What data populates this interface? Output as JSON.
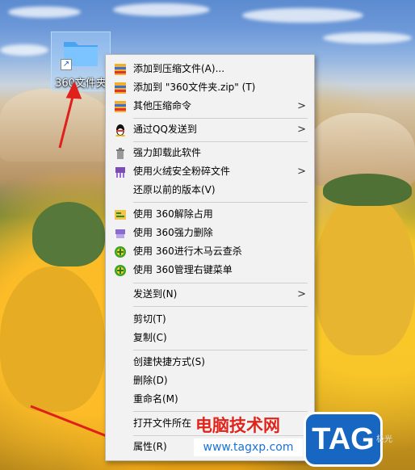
{
  "desktop_icon": {
    "label": "360文件夹"
  },
  "context_menu": {
    "items": [
      {
        "label": "添加到压缩文件(A)...",
        "icon": "archive-icon",
        "submenu": false
      },
      {
        "label": "添加到 \"360文件夹.zip\" (T)",
        "icon": "archive-icon",
        "submenu": false
      },
      {
        "label": "其他压缩命令",
        "icon": "archive-icon",
        "submenu": true
      },
      {
        "label": "通过QQ发送到",
        "icon": "qq-penguin-icon",
        "submenu": true
      },
      {
        "label": "强力卸载此软件",
        "icon": "trash-icon",
        "submenu": false
      },
      {
        "label": "使用火绒安全粉碎文件",
        "icon": "shredder-icon",
        "submenu": true
      },
      {
        "label": "还原以前的版本(V)",
        "icon": "",
        "submenu": false
      },
      {
        "label": "使用 360解除占用",
        "icon": "unlock-file-icon",
        "submenu": false
      },
      {
        "label": "使用 360强力删除",
        "icon": "shred-delete-icon",
        "submenu": false
      },
      {
        "label": "使用 360进行木马云查杀",
        "icon": "360-shield-icon",
        "submenu": false
      },
      {
        "label": "使用 360管理右键菜单",
        "icon": "360-shield-icon",
        "submenu": false
      },
      {
        "label": "发送到(N)",
        "icon": "",
        "submenu": true
      },
      {
        "label": "剪切(T)",
        "icon": "",
        "submenu": false
      },
      {
        "label": "复制(C)",
        "icon": "",
        "submenu": false
      },
      {
        "label": "创建快捷方式(S)",
        "icon": "",
        "submenu": false
      },
      {
        "label": "删除(D)",
        "icon": "",
        "submenu": false
      },
      {
        "label": "重命名(M)",
        "icon": "",
        "submenu": false
      },
      {
        "label": "打开文件所在",
        "icon": "",
        "submenu": false
      },
      {
        "label": "属性(R)",
        "icon": "",
        "submenu": false
      }
    ]
  },
  "watermark": {
    "site_name": "电脑技术网",
    "url": "www.tagxp.com",
    "logo_text": "TAG",
    "logo_suffix": "极光"
  },
  "colors": {
    "annotation_arrow": "#e0201b",
    "menu_bg": "#f2f2f2",
    "watermark_red": "#e1241b",
    "watermark_blue": "#1766c2"
  }
}
